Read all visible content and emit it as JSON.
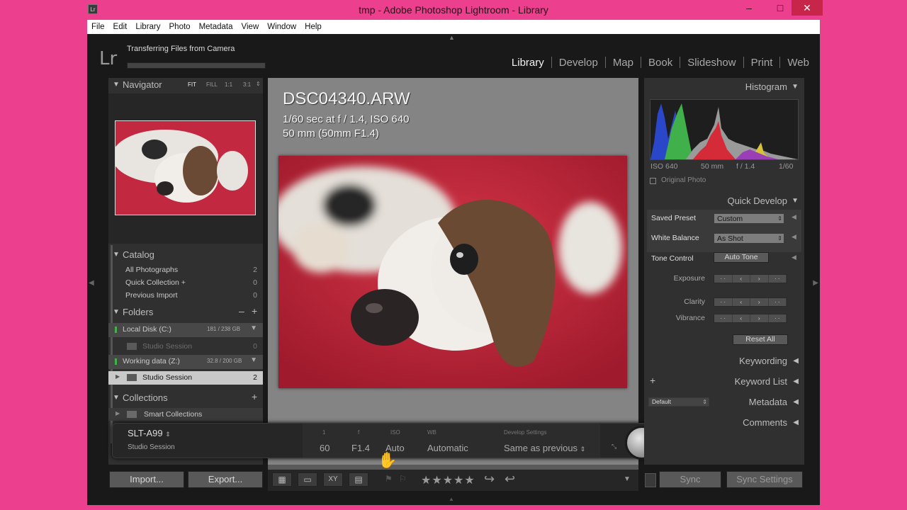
{
  "window": {
    "title": "tmp - Adobe Photoshop Lightroom - Library",
    "app_icon": "Lr",
    "controls": [
      "–",
      "□",
      "✕"
    ]
  },
  "menu": [
    "File",
    "Edit",
    "Library",
    "Photo",
    "Metadata",
    "View",
    "Window",
    "Help"
  ],
  "identity": {
    "logo": "Lr",
    "status": "Transferring Files from Camera",
    "progress": 0
  },
  "modules": [
    "Library",
    "Develop",
    "Map",
    "Book",
    "Slideshow",
    "Print",
    "Web"
  ],
  "navigator": {
    "title": "Navigator",
    "zoom": [
      "FIT",
      "FILL",
      "1:1",
      "3:1"
    ]
  },
  "catalog": {
    "title": "Catalog",
    "items": [
      {
        "label": "All Photographs",
        "count": "2"
      },
      {
        "label": "Quick Collection  +",
        "count": "0"
      },
      {
        "label": "Previous Import",
        "count": "0"
      }
    ]
  },
  "folders": {
    "title": "Folders",
    "volumes": [
      {
        "label": "Local Disk (C:)",
        "size": "181 / 238 GB"
      },
      {
        "label": "Working data (Z:)",
        "size": "32.8 / 200 GB"
      }
    ],
    "items": [
      {
        "label": "Studio Session",
        "count": "0"
      },
      {
        "label": "Studio Session",
        "count": "2"
      }
    ]
  },
  "collections": {
    "title": "Collections",
    "items": [
      {
        "label": "Smart Collections"
      }
    ]
  },
  "left_buttons": {
    "import": "Import...",
    "export": "Export..."
  },
  "photo_info": {
    "filename": "DSC04340.ARW",
    "exposure": "1/60 sec at f / 1.4, ISO 640",
    "lens": "50 mm (50mm F1.4)"
  },
  "histogram": {
    "title": "Histogram",
    "iso": "ISO 640",
    "focal": "50 mm",
    "aperture": "f / 1.4",
    "shutter": "1/60",
    "original_photo": "Original Photo"
  },
  "quick_develop": {
    "title": "Quick Develop",
    "saved_preset_label": "Saved Preset",
    "saved_preset_value": "Custom",
    "white_balance_label": "White Balance",
    "white_balance_value": "As Shot",
    "tone_control_label": "Tone Control",
    "auto_tone": "Auto Tone",
    "exposure": "Exposure",
    "clarity": "Clarity",
    "vibrance": "Vibrance",
    "reset_all": "Reset All"
  },
  "right_panels": {
    "keywording": "Keywording",
    "keyword_list": "Keyword List",
    "metadata": "Metadata",
    "metadata_preset": "Default",
    "comments": "Comments"
  },
  "right_buttons": {
    "sync": "Sync",
    "sync_settings": "Sync Settings"
  },
  "import_bar": {
    "camera": "SLT-A99",
    "session": "Studio Session",
    "shutter_label": "1",
    "shutter": "60",
    "aperture_label": "f",
    "aperture": "F1.4",
    "iso_label": "ISO",
    "iso": "Auto",
    "wb_label": "WB",
    "wb": "Automatic",
    "develop_label": "Develop Settings",
    "develop": "Same as previous"
  },
  "toolbar": {
    "stars": "★★★★★"
  },
  "colors": {
    "accent_pink": "#ec3f8d",
    "panel": "#303030",
    "center": "#808080",
    "photo_red": "#c2283f"
  }
}
